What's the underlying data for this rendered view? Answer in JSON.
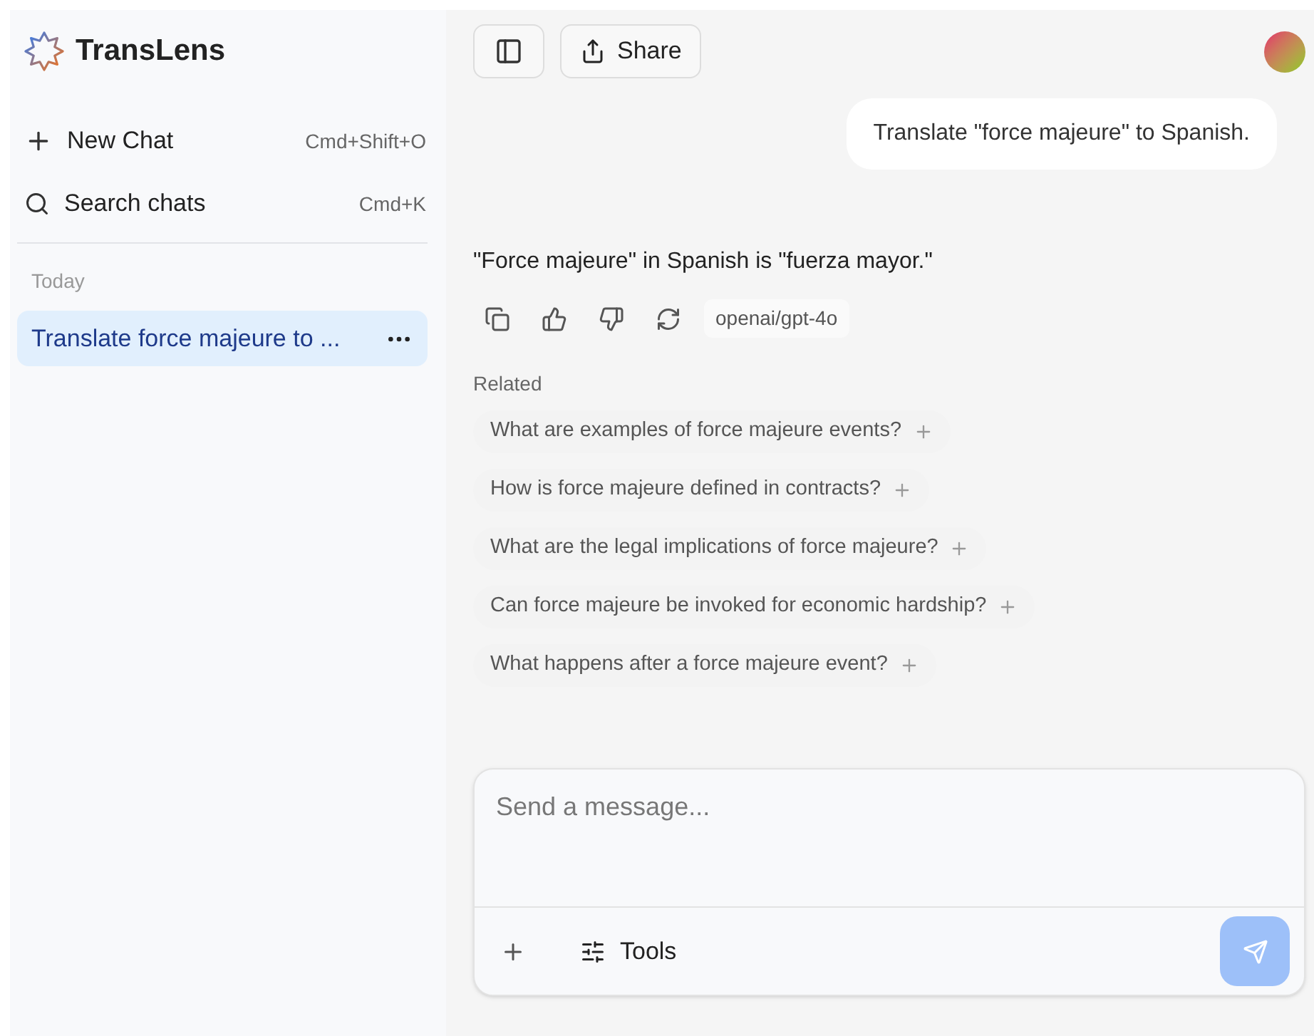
{
  "sidebar": {
    "brand": "TransLens",
    "actions": [
      {
        "kind": "new",
        "label": "New Chat",
        "shortcut": "Cmd+Shift+O"
      },
      {
        "kind": "search",
        "label": "Search chats",
        "shortcut": "Cmd+K"
      }
    ],
    "group_label": "Today",
    "chats": [
      {
        "title": "Translate force majeure to ...",
        "selected": true
      }
    ]
  },
  "toolbar": {
    "share": "Share"
  },
  "conversation": {
    "user_message": "Translate \"force majeure\" to Spanish.",
    "answer": "\"Force majeure\" in Spanish is \"fuerza mayor.\"",
    "model": "openai/gpt-4o",
    "related_label": "Related",
    "related": [
      "What are examples of force majeure events?",
      "How is force majeure defined in contracts?",
      "What are the legal implications of force majeure?",
      "Can force majeure be invoked for economic hardship?",
      "What happens after a force majeure event?"
    ]
  },
  "composer": {
    "placeholder": "Send a message...",
    "tools": "Tools",
    "send_disabled": true
  }
}
